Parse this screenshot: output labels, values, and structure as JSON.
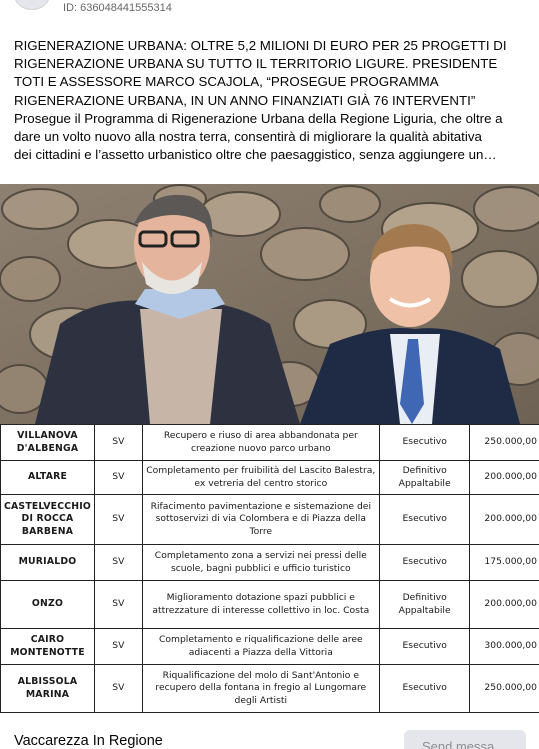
{
  "post": {
    "id_text": "ID: 636048441555314",
    "headline": "RIGENERAZIONE URBANA: OLTRE 5,2 MILIONI DI EURO PER 25 PROGETTI DI RIGENERAZIONE URBANA SU TUTTO IL TERRITORIO LIGURE. PRESIDENTE TOTI E ASSESSORE MARCO SCAJOLA, “PROSEGUE PROGRAMMA RIGENERAZIONE URBANA, IN UN ANNO FINANZIATI GIÀ 76 INTERVENTI”",
    "body_line1": "Prosegue il Programma di Rigenerazione Urbana della Regione Liguria, che oltre a",
    "body_line2": "dare un volto nuovo alla nostra terra, consentirà di migliorare la qualità abitativa",
    "body_line3": "dei cittadini e l’assetto urbanistico oltre che paesaggistico, senza aggiungere un…"
  },
  "table": {
    "rows": [
      {
        "city": "VILLANOVA D'ALBENGA",
        "prov": "SV",
        "desc": "Recupero e riuso di area abbandonata per creazione nuovo parco urbano",
        "status": "Esecutivo",
        "amount": "250.000,00"
      },
      {
        "city": "ALTARE",
        "prov": "SV",
        "desc": "Completamento per fruibilità del Lascito Balestra, ex vetreria del centro storico",
        "status": "Definitivo Appaltabile",
        "amount": "200.000,00"
      },
      {
        "city": "CASTELVECCHIO DI ROCCA BARBENA",
        "prov": "SV",
        "desc": "Rifacimento pavimentazione e sistemazione dei sottoservizi di via Colombera e di Piazza della Torre",
        "status": "Esecutivo",
        "amount": "200.000,00"
      },
      {
        "city": "MURIALDO",
        "prov": "SV",
        "desc": "Completamento zona a servizi nei pressi delle scuole, bagni pubblici e ufficio turistico",
        "status": "Esecutivo",
        "amount": "175.000,00"
      },
      {
        "city": "ONZO",
        "prov": "SV",
        "desc": "Miglioramento dotazione spazi pubblici e attrezzature di interesse collettivo in loc. Costa",
        "status": "Definitivo Appaltabile",
        "amount": "200.000,00"
      },
      {
        "city": "CAIRO MONTENOTTE",
        "prov": "SV",
        "desc": "Completamento e riqualificazione delle aree adiacenti a Piazza della Vittoria",
        "status": "Esecutivo",
        "amount": "300.000,00"
      },
      {
        "city": "ALBISSOLA MARINA",
        "prov": "SV",
        "desc": "Riqualificazione del molo di Sant'Antonio e recupero della fontana in fregio al Lungomare degli Artisti",
        "status": "Esecutivo",
        "amount": "250.000,00"
      }
    ]
  },
  "footer": {
    "page_name": "Vaccarezza In Regione",
    "send_button": "Send messa"
  }
}
